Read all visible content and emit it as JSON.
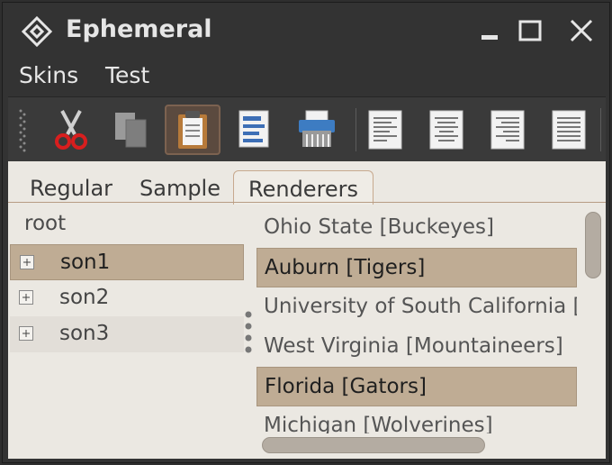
{
  "window": {
    "title": "Ephemeral"
  },
  "menubar": {
    "items": [
      {
        "label": "Skins"
      },
      {
        "label": "Test"
      }
    ]
  },
  "toolbar": {
    "buttons": [
      {
        "icon": "scissors-icon"
      },
      {
        "icon": "copy-icon"
      },
      {
        "icon": "clipboard-icon",
        "active": true
      },
      {
        "icon": "document-icon"
      },
      {
        "icon": "printer-icon"
      },
      {
        "icon": "align-left-icon"
      },
      {
        "icon": "align-center-icon"
      },
      {
        "icon": "align-right-icon"
      },
      {
        "icon": "align-justify-icon"
      }
    ]
  },
  "tabs": [
    {
      "label": "Regular"
    },
    {
      "label": "Sample"
    },
    {
      "label": "Renderers",
      "selected": true
    }
  ],
  "tree": {
    "root": "root",
    "children": [
      {
        "label": "son1",
        "selected": true
      },
      {
        "label": "son2"
      },
      {
        "label": "son3"
      }
    ]
  },
  "list": {
    "items": [
      {
        "label": "Ohio State [Buckeyes]"
      },
      {
        "label": "Auburn [Tigers]",
        "selected": true
      },
      {
        "label": "University of South California [Trojans]"
      },
      {
        "label": "West Virginia [Mountaineers]"
      },
      {
        "label": "Florida [Gators]",
        "selected": true
      },
      {
        "label": "Michigan [Wolverines]"
      }
    ]
  },
  "colors": {
    "selection": "#bfac94",
    "accent_border": "#c7a98e",
    "window_bg": "#333333",
    "content_bg": "#ebe8e2"
  }
}
